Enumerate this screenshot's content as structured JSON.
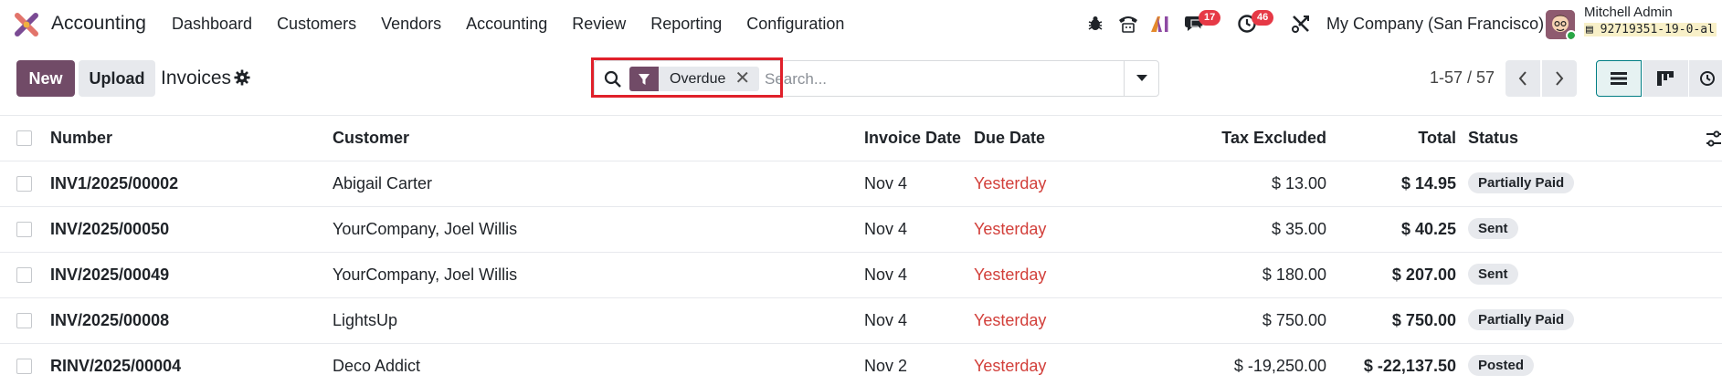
{
  "navbar": {
    "app_name": "Accounting",
    "menu": [
      "Dashboard",
      "Customers",
      "Vendors",
      "Accounting",
      "Review",
      "Reporting",
      "Configuration"
    ],
    "messages_badge": "17",
    "activities_badge": "46",
    "company": "My Company (San Francisco)",
    "user_name": "Mitchell Admin",
    "db_name": "92719351-19-0-al"
  },
  "control": {
    "new_label": "New",
    "upload_label": "Upload",
    "title": "Invoices",
    "facet_label": "Overdue",
    "search_placeholder": "Search...",
    "pager_value": "1-57 / 57"
  },
  "table": {
    "headers": {
      "number": "Number",
      "customer": "Customer",
      "invoice_date": "Invoice Date",
      "due_date": "Due Date",
      "tax_excluded": "Tax Excluded",
      "total": "Total",
      "status": "Status"
    },
    "rows": [
      {
        "number": "INV1/2025/00002",
        "customer": "Abigail Carter",
        "invoice_date": "Nov 4",
        "due_date": "Yesterday",
        "tax_excluded": "$ 13.00",
        "total": "$ 14.95",
        "status": "Partially Paid"
      },
      {
        "number": "INV/2025/00050",
        "customer": "YourCompany, Joel Willis",
        "invoice_date": "Nov 4",
        "due_date": "Yesterday",
        "tax_excluded": "$ 35.00",
        "total": "$ 40.25",
        "status": "Sent"
      },
      {
        "number": "INV/2025/00049",
        "customer": "YourCompany, Joel Willis",
        "invoice_date": "Nov 4",
        "due_date": "Yesterday",
        "tax_excluded": "$ 180.00",
        "total": "$ 207.00",
        "status": "Sent"
      },
      {
        "number": "INV/2025/00008",
        "customer": "LightsUp",
        "invoice_date": "Nov 4",
        "due_date": "Yesterday",
        "tax_excluded": "$ 750.00",
        "total": "$ 750.00",
        "status": "Partially Paid"
      },
      {
        "number": "RINV/2025/00004",
        "customer": "Deco Addict",
        "invoice_date": "Nov 2",
        "due_date": "Yesterday",
        "tax_excluded": "$ -19,250.00",
        "total": "$ -22,137.50",
        "status": "Posted"
      }
    ]
  },
  "colors": {
    "brand": "#714b67",
    "overdue_text": "#d23f3a",
    "highlight_box": "#e0202a",
    "badge": "#e63946"
  },
  "icons": [
    "app-logo-icon",
    "bug-icon",
    "phone-icon",
    "ai-icon",
    "chat-icon",
    "clock-icon",
    "tools-icon",
    "database-icon",
    "gear-icon",
    "search-icon",
    "filter-icon",
    "close-icon",
    "caret-down-icon",
    "chevron-left-icon",
    "chevron-right-icon",
    "list-view-icon",
    "kanban-view-icon",
    "activity-view-icon",
    "column-options-icon"
  ]
}
